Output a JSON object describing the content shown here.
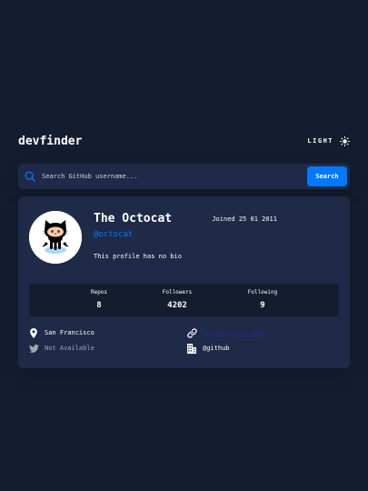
{
  "app": {
    "logo": "devfinder",
    "theme_label": "LIGHT",
    "icons": {
      "theme": "sun-icon",
      "search": "search-icon"
    }
  },
  "search": {
    "placeholder": "Search GitHub username...",
    "value": "",
    "button_label": "Search"
  },
  "profile": {
    "name": "The Octocat",
    "login": "@octocat",
    "joined": "Joined 25 01 2011",
    "bio": "This profile has no bio",
    "stats": [
      {
        "label": "Repos",
        "value": "8"
      },
      {
        "label": "Followers",
        "value": "4202"
      },
      {
        "label": "Following",
        "value": "9"
      }
    ],
    "info": {
      "location": "San Francisco",
      "twitter": "Not Available",
      "blog": "https://github.blog",
      "company": "@github"
    }
  },
  "colors": {
    "background": "#141d2f",
    "card": "#1e2a47",
    "accent": "#0079ff",
    "muted": "#a1a8b8"
  }
}
